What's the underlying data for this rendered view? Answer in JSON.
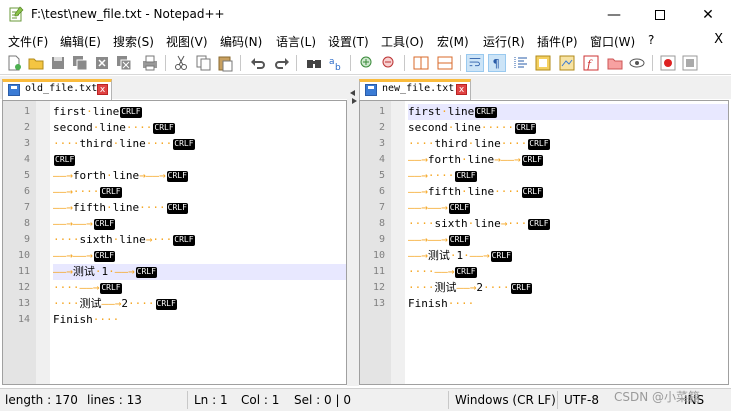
{
  "window": {
    "title": "F:\\test\\new_file.txt - Notepad++",
    "minimize_glyph": "—",
    "close_glyph": "✕"
  },
  "menu": [
    {
      "label": "文件(F)"
    },
    {
      "label": "编辑(E)"
    },
    {
      "label": "搜索(S)"
    },
    {
      "label": "视图(V)"
    },
    {
      "label": "编码(N)"
    },
    {
      "label": "语言(L)"
    },
    {
      "label": "设置(T)"
    },
    {
      "label": "工具(O)"
    },
    {
      "label": "宏(M)"
    },
    {
      "label": "运行(R)"
    },
    {
      "label": "插件(P)"
    },
    {
      "label": "窗口(W)"
    },
    {
      "label": "?"
    }
  ],
  "menu_close": "X",
  "left_pane": {
    "tab_label": "old_file.txt",
    "tab_close": "x",
    "line_numbers": [
      "1",
      "2",
      "3",
      "4",
      "5",
      "6",
      "7",
      "8",
      "9",
      "10",
      "11",
      "12",
      "13",
      "14"
    ],
    "lines": [
      {
        "pre": "first",
        "mid": "·",
        "text": "line",
        "tail": "",
        "eol": "CRLF"
      },
      {
        "pre": "second",
        "mid": "·",
        "text": "line",
        "tail": "····",
        "eol": "CRLF"
      },
      {
        "pre": "····third",
        "mid": "·",
        "text": "line",
        "tail": "····",
        "eol": "CRLF"
      },
      {
        "pre": "",
        "mid": "",
        "text": "",
        "tail": "",
        "eol": "CRLF"
      },
      {
        "pre": "——→forth",
        "mid": "·",
        "text": "line",
        "tail": "→——→",
        "eol": "CRLF"
      },
      {
        "pre": "——→····",
        "mid": "",
        "text": "",
        "tail": "",
        "eol": "CRLF"
      },
      {
        "pre": "——→fifth",
        "mid": "·",
        "text": "line",
        "tail": "····",
        "eol": "CRLF"
      },
      {
        "pre": "——→——→",
        "mid": "",
        "text": "",
        "tail": "",
        "eol": "CRLF"
      },
      {
        "pre": "····sixth",
        "mid": "·",
        "text": "line",
        "tail": "→···",
        "eol": "CRLF"
      },
      {
        "pre": "——→——→",
        "mid": "",
        "text": "",
        "tail": "",
        "eol": "CRLF"
      },
      {
        "pre": "——→测试",
        "mid": "·",
        "text": "1",
        "tail": "·——→",
        "eol": "CRLF"
      },
      {
        "pre": "····——→",
        "mid": "",
        "text": "",
        "tail": "",
        "eol": "CRLF"
      },
      {
        "pre": "····测试",
        "mid": "——→",
        "text": "2",
        "tail": "····",
        "eol": "CRLF"
      },
      {
        "pre": "Finish",
        "mid": "",
        "text": "",
        "tail": "····",
        "eol": ""
      }
    ]
  },
  "right_pane": {
    "tab_label": "new_file.txt",
    "tab_close": "x",
    "line_numbers": [
      "1",
      "2",
      "3",
      "4",
      "5",
      "6",
      "7",
      "8",
      "9",
      "10",
      "11",
      "12",
      "13"
    ],
    "lines": [
      {
        "pre": "first",
        "mid": "·",
        "text": "line",
        "tail": "",
        "eol": "CRLF"
      },
      {
        "pre": "second",
        "mid": "·",
        "text": "line",
        "tail": "·····",
        "eol": "CRLF"
      },
      {
        "pre": "····third",
        "mid": "·",
        "text": "line",
        "tail": "····",
        "eol": "CRLF"
      },
      {
        "pre": "——→forth",
        "mid": "·",
        "text": "line",
        "tail": "→——→",
        "eol": "CRLF"
      },
      {
        "pre": "——→····",
        "mid": "",
        "text": "",
        "tail": "",
        "eol": "CRLF"
      },
      {
        "pre": "——→fifth",
        "mid": "·",
        "text": "line",
        "tail": "····",
        "eol": "CRLF"
      },
      {
        "pre": "——→——→",
        "mid": "",
        "text": "",
        "tail": "",
        "eol": "CRLF"
      },
      {
        "pre": "····sixth",
        "mid": "·",
        "text": "line",
        "tail": "→···",
        "eol": "CRLF"
      },
      {
        "pre": "——→——→",
        "mid": "",
        "text": "",
        "tail": "",
        "eol": "CRLF"
      },
      {
        "pre": "——→测试",
        "mid": "·",
        "text": "1",
        "tail": "·——→",
        "eol": "CRLF"
      },
      {
        "pre": "····——→",
        "mid": "",
        "text": "",
        "tail": "",
        "eol": "CRLF"
      },
      {
        "pre": "····测试",
        "mid": "——→",
        "text": "2",
        "tail": "····",
        "eol": "CRLF"
      },
      {
        "pre": "Finish",
        "mid": "",
        "text": "",
        "tail": "····",
        "eol": ""
      }
    ]
  },
  "status": {
    "length": "length : 170",
    "lines": "lines : 13",
    "ln": "Ln : 1",
    "col": "Col : 1",
    "sel": "Sel : 0 | 0",
    "eol_mode": "Windows (CR LF)",
    "encoding": "UTF-8",
    "ins": "INS"
  },
  "watermark": "CSDN @小菜籍",
  "colors": {
    "whitespace": "#f5a623",
    "current_line": "#e8e8ff",
    "tab_accent": "#fabb3c"
  }
}
